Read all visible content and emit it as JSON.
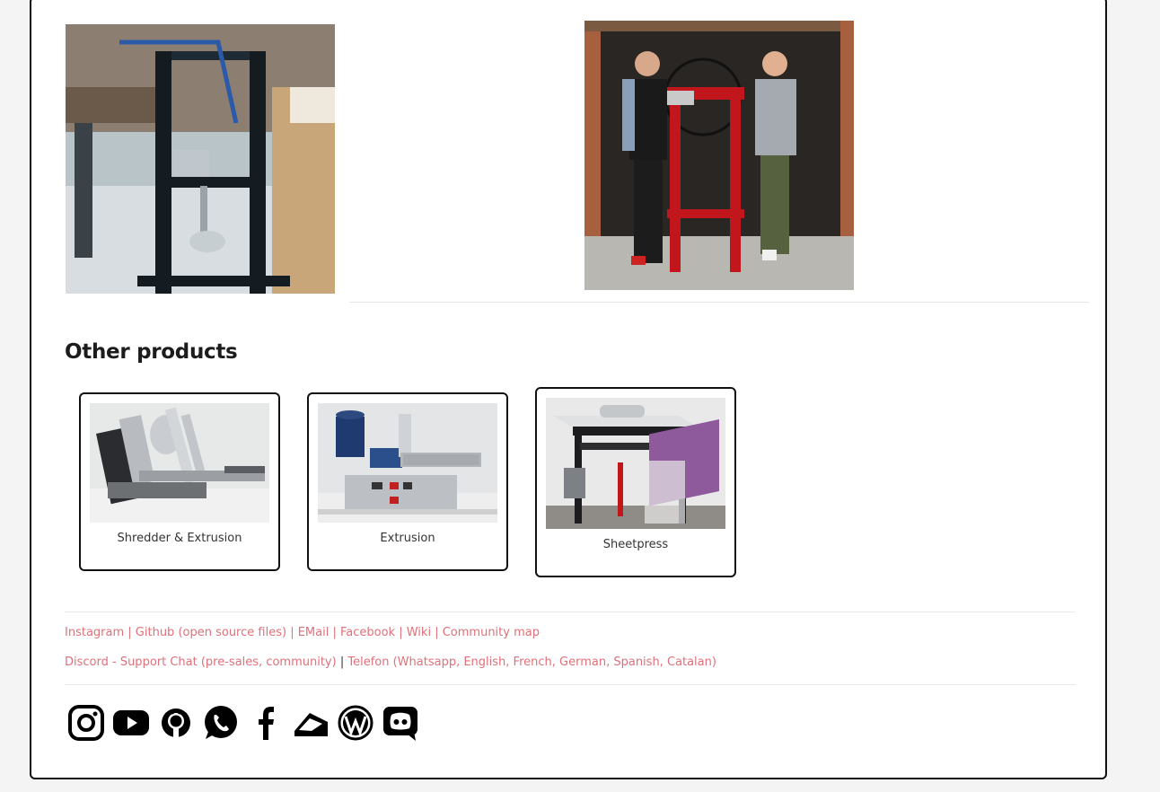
{
  "page": {
    "section_title": "Other products"
  },
  "products": [
    {
      "label": "Shredder & Extrusion"
    },
    {
      "label": "Extrusion"
    },
    {
      "label": "Sheetpress"
    }
  ],
  "footer": {
    "links_row1": [
      {
        "text": "Instagram"
      },
      {
        "text": "Github (open source files)"
      },
      {
        "text": "EMail"
      },
      {
        "text": "Facebook"
      },
      {
        "text": "Wiki"
      },
      {
        "text": "Community map"
      }
    ],
    "links_row2": [
      {
        "text": "Discord - Support Chat (pre-sales, community)"
      },
      {
        "text": "Telefon (Whatsapp, English, French, German, Spanish, Catalan)"
      }
    ],
    "separator": "|",
    "social_icons": [
      "instagram-icon",
      "youtube-icon",
      "github-icon",
      "whatsapp-icon",
      "facebook-icon",
      "email-icon",
      "wordpress-icon",
      "discord-icon"
    ]
  },
  "colors": {
    "link": "#e0707a",
    "border": "#111111",
    "background": "#f4f4f4"
  }
}
